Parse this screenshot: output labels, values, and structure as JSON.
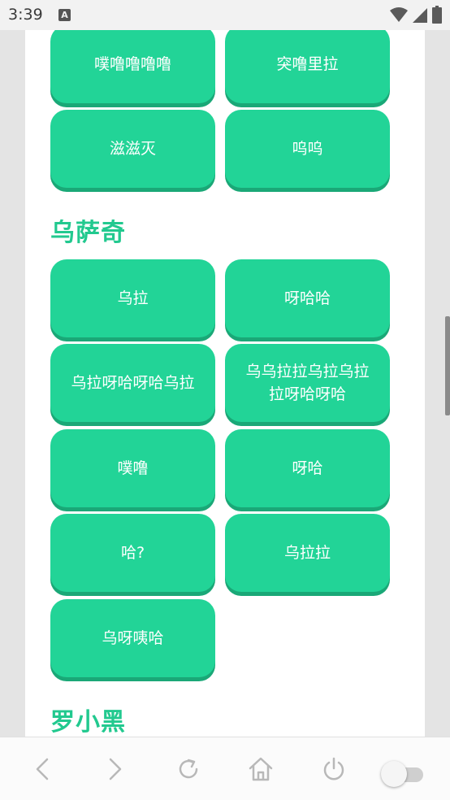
{
  "status_bar": {
    "time": "3:39",
    "notification_icon": "A",
    "icons": [
      "wifi-icon",
      "signal-icon",
      "battery-icon"
    ]
  },
  "sections": [
    {
      "title": "",
      "buttons": [
        "噗噜噜噜噜",
        "突噜里拉",
        "滋滋灭",
        "呜呜"
      ]
    },
    {
      "title": "乌萨奇",
      "buttons": [
        "乌拉",
        "呀哈哈",
        "乌拉呀哈呀哈乌拉",
        "乌乌拉拉乌拉乌拉拉呀哈呀哈",
        "噗噜",
        "呀哈",
        "哈?",
        "乌拉拉",
        "乌呀咦哈"
      ]
    },
    {
      "title": "罗小黑",
      "buttons": []
    }
  ],
  "nav_bar": {
    "icons": [
      "back-icon",
      "forward-icon",
      "refresh-icon",
      "home-icon",
      "power-icon",
      "toggle-switch"
    ],
    "toggle_on": false
  },
  "colors": {
    "accent": "#22d497",
    "accent_shadow": "#1aa877",
    "title": "#22c98f"
  }
}
